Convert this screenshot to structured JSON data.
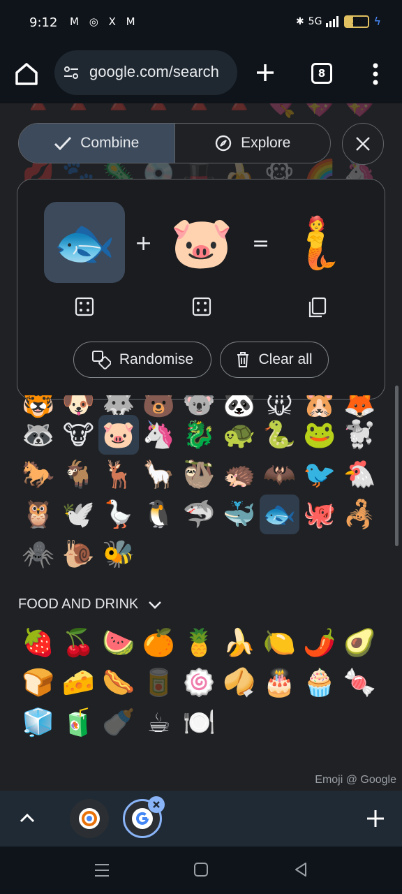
{
  "status_bar": {
    "time": "9:12",
    "notification_icons": "M ◎ X M",
    "network": "5G",
    "battery": "34"
  },
  "toolbar": {
    "url": "google.com/search",
    "tab_count": "8"
  },
  "segmented": {
    "combine_label": "Combine",
    "explore_label": "Explore"
  },
  "combine_card": {
    "first_emoji": "🐟",
    "plus": "+",
    "second_emoji": "🐷",
    "equals": "=",
    "result_emoji": "🧜",
    "randomise_label": "Randomise",
    "clear_all_label": "Clear all"
  },
  "emoji_rows": {
    "top_faded": [
      "🔺",
      "🔺",
      "🔺",
      "🔺",
      "🔺",
      "🔺",
      "💘",
      "💖",
      "💖"
    ],
    "second_faded": [
      "💋",
      "🐾",
      "🦠",
      "💿",
      "🎩",
      "🍌",
      "🐵",
      "🌈",
      "🦄"
    ],
    "animals_partial": [
      "🐯",
      "🐶",
      "🐺",
      "🐻",
      "🐨",
      "🐼",
      "🐭",
      "🐹",
      "🦊"
    ],
    "animals": [
      [
        "🦝",
        "🐮",
        "🐷",
        "🦄",
        "🐉",
        "🐢",
        "🐍",
        "🐸",
        "🐩"
      ],
      [
        "🐎",
        "🐐",
        "🦌",
        "🦙",
        "🦥",
        "🦔",
        "🦇",
        "🐦",
        "🐔"
      ],
      [
        "🦉",
        "🕊️",
        "🪿",
        "🐧",
        "🦈",
        "🐳",
        "🐟",
        "🐙",
        "🦂"
      ],
      [
        "🕷️",
        "🐌",
        "🐝"
      ]
    ],
    "food_header": "FOOD AND DRINK",
    "food": [
      [
        "🍓",
        "🍒",
        "🍉",
        "🍊",
        "🍍",
        "🍌",
        "🍋",
        "🌶️",
        "🥑"
      ],
      [
        "🍞",
        "🧀",
        "🌭",
        "🥫",
        "🍥",
        "🥠",
        "🎂",
        "🧁",
        "🍬"
      ],
      [
        "🧊",
        "🧃",
        "🍼",
        "☕",
        "🍽️"
      ]
    ]
  },
  "credit": "Emoji @ Google",
  "colors": {
    "background": "#202124",
    "chrome": "#0f141a",
    "accent": "#8ab4f8",
    "selected": "#3c4a5c"
  }
}
